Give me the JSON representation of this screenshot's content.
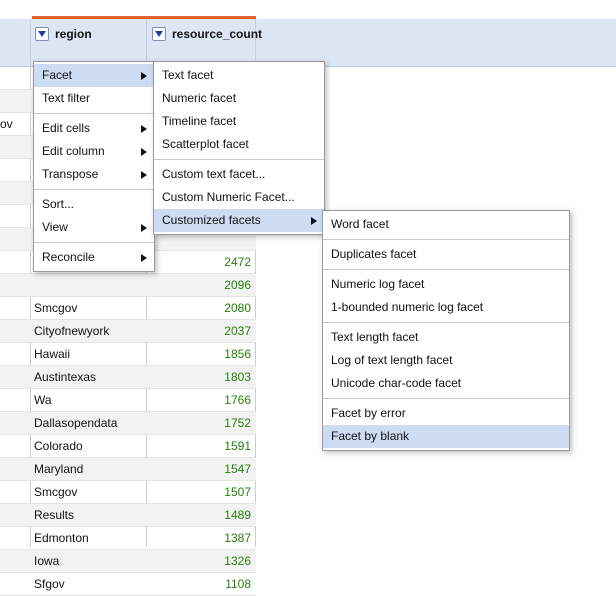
{
  "columns": {
    "region_label": "region",
    "count_label": "resource_count"
  },
  "stub_text": "ov",
  "rows": [
    {
      "region": "",
      "count": "2472"
    },
    {
      "region": "",
      "count": "2096"
    },
    {
      "region": "Smcgov",
      "count": "2080"
    },
    {
      "region": "Cityofnewyork",
      "count": "2037"
    },
    {
      "region": "Hawaii",
      "count": "1856"
    },
    {
      "region": "Austintexas",
      "count": "1803"
    },
    {
      "region": "Wa",
      "count": "1766"
    },
    {
      "region": "Dallasopendata",
      "count": "1752"
    },
    {
      "region": "Colorado",
      "count": "1591"
    },
    {
      "region": "Maryland",
      "count": "1547"
    },
    {
      "region": "Smcgov",
      "count": "1507"
    },
    {
      "region": "Results",
      "count": "1489"
    },
    {
      "region": "Edmonton",
      "count": "1387"
    },
    {
      "region": "Iowa",
      "count": "1326"
    },
    {
      "region": "Sfgov",
      "count": "1108"
    }
  ],
  "menu_main": {
    "facet": "Facet",
    "text_filter": "Text filter",
    "edit_cells": "Edit cells",
    "edit_column": "Edit column",
    "transpose": "Transpose",
    "sort": "Sort...",
    "view": "View",
    "reconcile": "Reconcile"
  },
  "menu_facet": {
    "text_facet": "Text facet",
    "numeric_facet": "Numeric facet",
    "timeline_facet": "Timeline facet",
    "scatterplot_facet": "Scatterplot facet",
    "custom_text_facet": "Custom text facet...",
    "custom_numeric_facet": "Custom Numeric Facet...",
    "customized_facets": "Customized facets"
  },
  "menu_customized": {
    "word_facet": "Word facet",
    "duplicates_facet": "Duplicates facet",
    "numeric_log_facet": "Numeric log facet",
    "bounded_log_facet": "1-bounded numeric log facet",
    "text_length_facet": "Text length facet",
    "log_text_length_facet": "Log of text length facet",
    "unicode_facet": "Unicode char-code facet",
    "facet_by_error": "Facet by error",
    "facet_by_blank": "Facet by blank"
  },
  "colors": {
    "accent": "#e8612c",
    "header_bg": "#dde6f5",
    "highlight": "#cddcf2",
    "count_text": "#27800e"
  }
}
